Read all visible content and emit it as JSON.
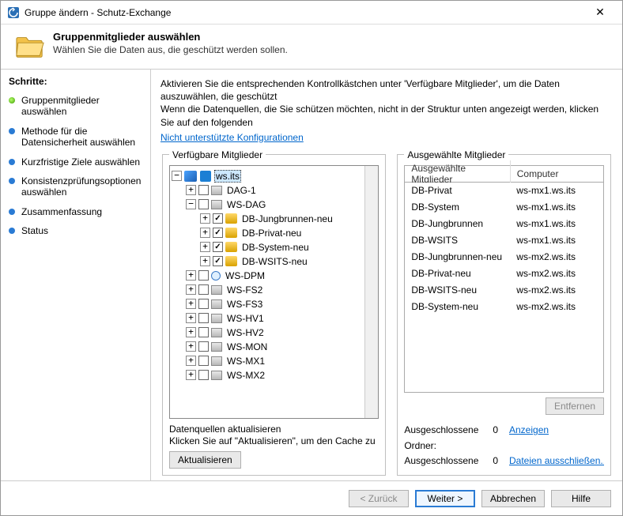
{
  "title": "Gruppe ändern - Schutz-Exchange",
  "header": {
    "heading": "Gruppenmitglieder auswählen",
    "sub": "Wählen Sie die Daten aus, die geschützt werden sollen."
  },
  "steps_title": "Schritte:",
  "steps": [
    "Gruppenmitglieder auswählen",
    "Methode für die Datensicherheit auswählen",
    "Kurzfristige Ziele auswählen",
    "Konsistenzprüfungsoptionen auswählen",
    "Zusammenfassung",
    "Status"
  ],
  "instr1": "Aktivieren Sie die entsprechenden Kontrollkästchen unter 'Verfügbare Mitglieder', um die Daten auszuwählen, die geschützt",
  "instr2": "Wenn die Datenquellen, die Sie schützen möchten, nicht in der Struktur unten angezeigt werden, klicken Sie auf den folgenden",
  "link": "Nicht unterstützte Konfigurationen",
  "left_legend": "Verfügbare Mitglieder",
  "right_legend": "Ausgewählte Mitglieder",
  "tree": {
    "root": "ws.its",
    "dag1": "DAG-1",
    "wsdag": "WS-DAG",
    "db1": "DB-Jungbrunnen-neu",
    "db2": "DB-Privat-neu",
    "db3": "DB-System-neu",
    "db4": "DB-WSITS-neu",
    "dpm": "WS-DPM",
    "fs2": "WS-FS2",
    "fs3": "WS-FS3",
    "hv1": "WS-HV1",
    "hv2": "WS-HV2",
    "mon": "WS-MON",
    "mx1": "WS-MX1",
    "mx2": "WS-MX2"
  },
  "refresh_head": "Datenquellen aktualisieren",
  "refresh_sub": "Klicken Sie auf \"Aktualisieren\", um den Cache zu",
  "refresh_btn": "Aktualisieren",
  "table": {
    "h1": "Ausgewählte Mitglieder",
    "h2": "Computer",
    "rows": [
      {
        "m": "DB-Privat",
        "c": "ws-mx1.ws.its"
      },
      {
        "m": "DB-System",
        "c": "ws-mx1.ws.its"
      },
      {
        "m": "DB-Jungbrunnen",
        "c": "ws-mx1.ws.its"
      },
      {
        "m": "DB-WSITS",
        "c": "ws-mx1.ws.its"
      },
      {
        "m": "DB-Jungbrunnen-neu",
        "c": "ws-mx2.ws.its"
      },
      {
        "m": "DB-Privat-neu",
        "c": "ws-mx2.ws.its"
      },
      {
        "m": "DB-WSITS-neu",
        "c": "ws-mx2.ws.its"
      },
      {
        "m": "DB-System-neu",
        "c": "ws-mx2.ws.its"
      }
    ]
  },
  "remove_btn": "Entfernen",
  "excl": {
    "folders_l": "Ausgeschlossene Ordner:",
    "folders_n": "0",
    "folders_a": "Anzeigen",
    "files_l": "Ausgeschlossene",
    "files_n": "0",
    "files_a": "Dateien ausschließen..."
  },
  "footer": {
    "back": "< Zurück",
    "next": "Weiter >",
    "cancel": "Abbrechen",
    "help": "Hilfe"
  }
}
